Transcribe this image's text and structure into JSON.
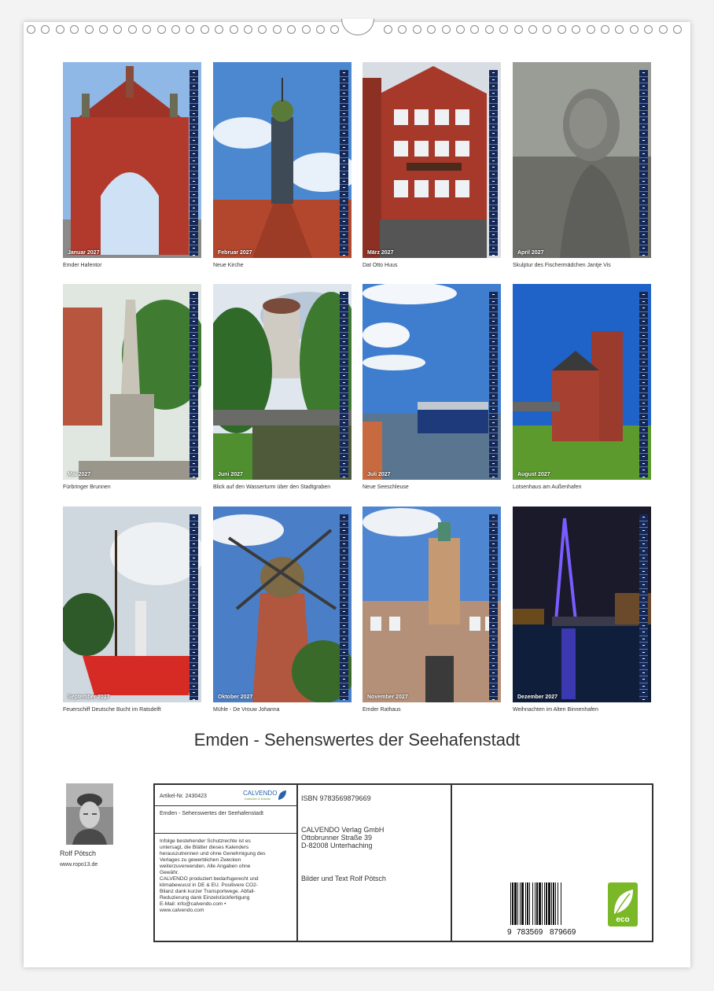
{
  "calendar": {
    "title": "Emden - Sehenswertes der Seehafenstadt",
    "months": [
      {
        "month": "Januar 2027",
        "caption": "Emder Hafentor"
      },
      {
        "month": "Februar 2027",
        "caption": "Neue Kirche"
      },
      {
        "month": "März 2027",
        "caption": "Dat Otto Huus"
      },
      {
        "month": "April 2027",
        "caption": "Skulptur des Fischermädchen Jantje Vis"
      },
      {
        "month": "Mai 2027",
        "caption": "Fürbringer Brunnen"
      },
      {
        "month": "Juni 2027",
        "caption": "Blick auf den Wasserturm über den Stadtgraben"
      },
      {
        "month": "Juli 2027",
        "caption": "Neue Seeschleuse"
      },
      {
        "month": "August 2027",
        "caption": "Lotsenhaus am Außenhafen"
      },
      {
        "month": "September 2027",
        "caption": "Feuerschiff Deutsche Bucht im Ratsdelft"
      },
      {
        "month": "Oktober 2027",
        "caption": "Mühle - De Vrouw Johanna"
      },
      {
        "month": "November 2027",
        "caption": "Emder Rathaus"
      },
      {
        "month": "Dezember 2027",
        "caption": "Weihnachten im Alten Binnenhafen"
      }
    ]
  },
  "author": {
    "name": "Rolf Pötsch",
    "website": "www.ropo13.de"
  },
  "imprint": {
    "article": "Artikel-Nr. 2430423",
    "logo_text": "CALVENDO",
    "logo_sub": "Kalender & Bücher",
    "product_title": "Emden - Sehenswertes der Seehafenstadt",
    "legal_lines": [
      "Infolge bestehender Schutzrechte ist es",
      "untersagt, die Blätter dieses Kalenders",
      "herauszutrennen und ohne Genehmigung des",
      "Verlages zu gewerblichen Zwecken",
      "weiterzuverwenden. Alle Angaben ohne",
      "Gewähr.",
      "CALVENDO produziert bedarfsgerecht und",
      "klimabewusst in DE & EU. Positivere CO2-",
      "Bilanz dank kurzer Transportwege. Abfall-",
      "Reduzierung dank Einzelstückfertigung",
      "E-Mail: info@calvendo.com •",
      "www.calvendo.com"
    ],
    "isbn": "ISBN 9783569879669",
    "publisher_lines": [
      "CALVENDO Verlag GmbH",
      "Ottobrunner Straße 39",
      "D-82008 Unterhaching"
    ],
    "credits": "Bilder und Text Rolf Pötsch",
    "barcode_digits": [
      "9",
      "783569",
      "879669"
    ],
    "eco_label": "eco"
  }
}
